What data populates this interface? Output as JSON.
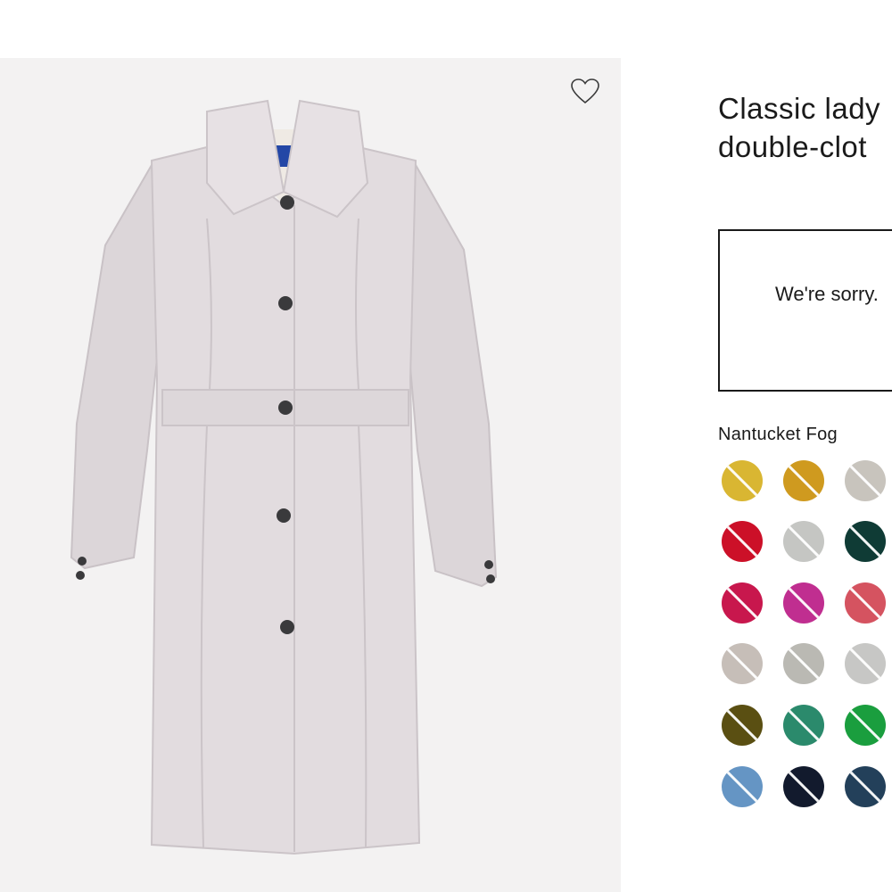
{
  "product": {
    "title_line1": "Classic lady",
    "title_line2": "double-clot",
    "availability_message": "We're sorry.",
    "selected_color_name": "Nantucket Fog",
    "favorite_icon": "heart-outline-icon",
    "image_label": "coat-image"
  },
  "swatches": [
    {
      "color": "#d9b632"
    },
    {
      "color": "#cf9a1f"
    },
    {
      "color": "#c8c4bd"
    },
    {
      "color": "#cc1028"
    },
    {
      "color": "#c5c6c3"
    },
    {
      "color": "#0f3b35"
    },
    {
      "color": "#c8174d"
    },
    {
      "color": "#c02e90"
    },
    {
      "color": "#d55360"
    },
    {
      "color": "#c6beb8"
    },
    {
      "color": "#bab9b3"
    },
    {
      "color": "#c7c7c5"
    },
    {
      "color": "#5a4f12"
    },
    {
      "color": "#2b8a6c"
    },
    {
      "color": "#1a9e3e"
    },
    {
      "color": "#6595c4"
    },
    {
      "color": "#121a2d"
    },
    {
      "color": "#23405a"
    }
  ]
}
